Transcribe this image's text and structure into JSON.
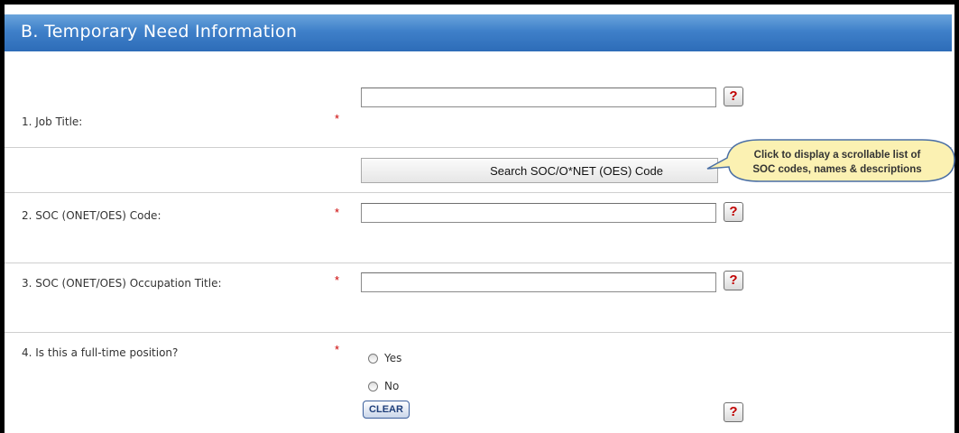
{
  "section": {
    "title": "B. Temporary Need Information"
  },
  "fields": {
    "job_title": {
      "label": "1. Job Title:",
      "value": ""
    },
    "soc_code": {
      "label": "2. SOC (ONET/OES) Code:",
      "value": ""
    },
    "soc_title": {
      "label": "3. SOC (ONET/OES) Occupation Title:",
      "value": ""
    },
    "full_time": {
      "label": "4. Is this a full-time position?",
      "options": [
        "Yes",
        "No"
      ],
      "clear_label": "CLEAR"
    }
  },
  "required_marker": "*",
  "help_glyph": "?",
  "search_button": {
    "label": "Search SOC/O*NET (OES) Code"
  },
  "callout": {
    "line1": "Click to display a scrollable list of",
    "line2": "SOC codes, names & descriptions"
  },
  "colors": {
    "header_blue": "#3f80c9",
    "required_red": "#cc0000",
    "help_red": "#c00000",
    "callout_fill": "#fbf1b2",
    "callout_border": "#4a6fa5"
  }
}
